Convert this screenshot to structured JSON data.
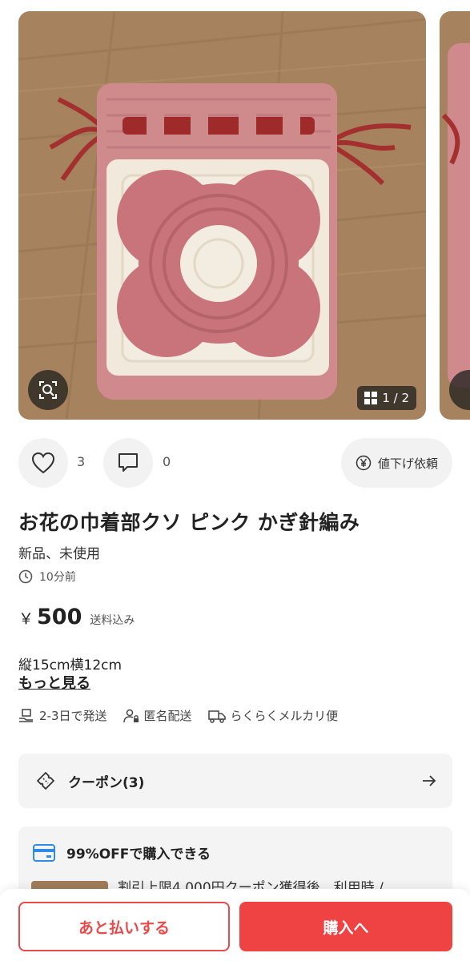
{
  "gallery": {
    "counter_text": "1 / 2",
    "image_alt": "crochet-drawstring-pouch-photo"
  },
  "actions": {
    "like_count": "3",
    "comment_count": "0",
    "offer_label": "値下げ依頼"
  },
  "item": {
    "title": "お花の巾着部クソ ピンク かぎ針編み",
    "condition": "新品、未使用",
    "posted": "10分前",
    "price_symbol": "￥",
    "price": "500",
    "shipping_note": "送料込み",
    "description": "縦15cm横12cm",
    "more_link": "もっと見る"
  },
  "shipping": {
    "days": "2-3日で発送",
    "anonymous": "匿名配送",
    "method": "らくらくメルカリ便"
  },
  "coupon": {
    "label": "クーポン(3)"
  },
  "promo": {
    "headline": "99%OFFで購入できる",
    "detail": "割引上限4,000円クーポン獲得後、利用時 /"
  },
  "bottom": {
    "pay_later_label": "あと払いする",
    "buy_label": "購入へ"
  },
  "colors": {
    "accent_red": "#ef4242",
    "wood": "#a88461",
    "yarn_pink": "#c9747a",
    "yarn_cream": "#f3ece0",
    "yarn_dark_red": "#9e2a2a"
  }
}
